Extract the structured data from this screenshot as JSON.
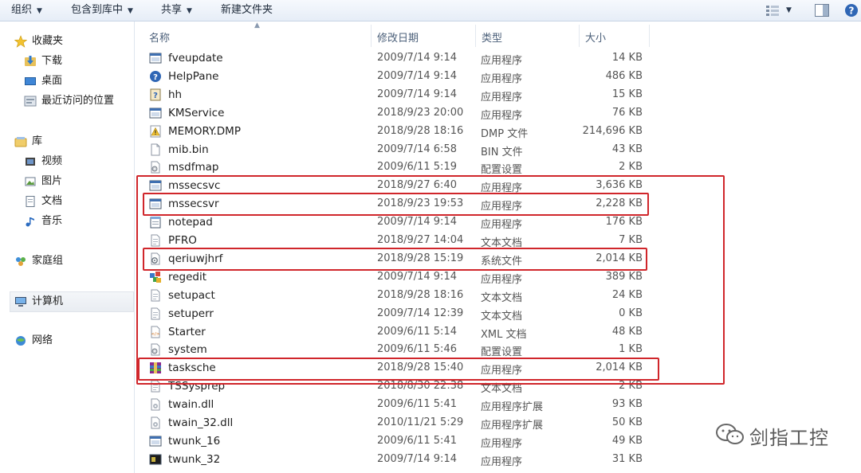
{
  "toolbar": {
    "organize": "组织",
    "include_in_library": "包含到库中",
    "share": "共享",
    "new_folder": "新建文件夹",
    "icons": [
      "view-icon",
      "chevron-down-icon",
      "preview-pane-icon",
      "help-icon"
    ]
  },
  "sidebar": {
    "favorites": {
      "label": "收藏夹",
      "icon": "star-icon"
    },
    "favorites_items": [
      {
        "label": "下载",
        "icon": "download-folder-icon"
      },
      {
        "label": "桌面",
        "icon": "desktop-icon"
      },
      {
        "label": "最近访问的位置",
        "icon": "recent-places-icon"
      }
    ],
    "libraries": {
      "label": "库",
      "icon": "library-icon"
    },
    "libraries_items": [
      {
        "label": "视频",
        "icon": "video-icon"
      },
      {
        "label": "图片",
        "icon": "picture-icon"
      },
      {
        "label": "文档",
        "icon": "document-icon"
      },
      {
        "label": "音乐",
        "icon": "music-icon"
      }
    ],
    "homegroup": {
      "label": "家庭组",
      "icon": "homegroup-icon"
    },
    "computer": {
      "label": "计算机",
      "icon": "computer-icon"
    },
    "network": {
      "label": "网络",
      "icon": "network-icon"
    }
  },
  "columns": {
    "name": "名称",
    "date": "修改日期",
    "type": "类型",
    "size": "大小"
  },
  "files": [
    {
      "name": "fveupdate",
      "date": "2009/7/14 9:14",
      "type": "应用程序",
      "size": "14 KB",
      "icon": "app-icon"
    },
    {
      "name": "HelpPane",
      "date": "2009/7/14 9:14",
      "type": "应用程序",
      "size": "486 KB",
      "icon": "help-app-icon"
    },
    {
      "name": "hh",
      "date": "2009/7/14 9:14",
      "type": "应用程序",
      "size": "15 KB",
      "icon": "help-book-icon"
    },
    {
      "name": "KMService",
      "date": "2018/9/23 20:00",
      "type": "应用程序",
      "size": "76 KB",
      "icon": "app-icon"
    },
    {
      "name": "MEMORY.DMP",
      "date": "2018/9/28 18:16",
      "type": "DMP 文件",
      "size": "214,696 KB",
      "icon": "warning-file-icon"
    },
    {
      "name": "mib.bin",
      "date": "2009/7/14 6:58",
      "type": "BIN 文件",
      "size": "43 KB",
      "icon": "blank-file-icon"
    },
    {
      "name": "msdfmap",
      "date": "2009/6/11 5:19",
      "type": "配置设置",
      "size": "2 KB",
      "icon": "settings-file-icon"
    },
    {
      "name": "mssecsvc",
      "date": "2018/9/27 6:40",
      "type": "应用程序",
      "size": "3,636 KB",
      "icon": "app-icon"
    },
    {
      "name": "mssecsvr",
      "date": "2018/9/23 19:53",
      "type": "应用程序",
      "size": "2,228 KB",
      "icon": "app-icon"
    },
    {
      "name": "notepad",
      "date": "2009/7/14 9:14",
      "type": "应用程序",
      "size": "176 KB",
      "icon": "notepad-icon"
    },
    {
      "name": "PFRO",
      "date": "2018/9/27 14:04",
      "type": "文本文档",
      "size": "7 KB",
      "icon": "text-file-icon"
    },
    {
      "name": "qeriuwjhrf",
      "date": "2018/9/28 15:19",
      "type": "系统文件",
      "size": "2,014 KB",
      "icon": "system-file-icon"
    },
    {
      "name": "regedit",
      "date": "2009/7/14 9:14",
      "type": "应用程序",
      "size": "389 KB",
      "icon": "regedit-icon"
    },
    {
      "name": "setupact",
      "date": "2018/9/28 18:16",
      "type": "文本文档",
      "size": "24 KB",
      "icon": "text-file-icon"
    },
    {
      "name": "setuperr",
      "date": "2009/7/14 12:39",
      "type": "文本文档",
      "size": "0 KB",
      "icon": "text-file-icon"
    },
    {
      "name": "Starter",
      "date": "2009/6/11 5:14",
      "type": "XML 文档",
      "size": "48 KB",
      "icon": "xml-file-icon"
    },
    {
      "name": "system",
      "date": "2009/6/11 5:46",
      "type": "配置设置",
      "size": "1 KB",
      "icon": "settings-file-icon"
    },
    {
      "name": "tasksche",
      "date": "2018/9/28 15:40",
      "type": "应用程序",
      "size": "2,014 KB",
      "icon": "archive-app-icon"
    },
    {
      "name": "TSSysprep",
      "date": "2018/8/30 22:38",
      "type": "文本文档",
      "size": "2 KB",
      "icon": "text-file-icon"
    },
    {
      "name": "twain.dll",
      "date": "2009/6/11 5:41",
      "type": "应用程序扩展",
      "size": "93 KB",
      "icon": "dll-icon"
    },
    {
      "name": "twain_32.dll",
      "date": "2010/11/21 5:29",
      "type": "应用程序扩展",
      "size": "50 KB",
      "icon": "dll-icon"
    },
    {
      "name": "twunk_16",
      "date": "2009/6/11 5:41",
      "type": "应用程序",
      "size": "49 KB",
      "icon": "app-icon"
    },
    {
      "name": "twunk_32",
      "date": "2009/7/14 9:14",
      "type": "应用程序",
      "size": "31 KB",
      "icon": "terminal-app-icon"
    }
  ],
  "watermark": {
    "text": "剑指工控",
    "icon": "wechat-icon"
  },
  "colors": {
    "highlight": "#d0262b",
    "toolbar_bg": "#e6edf7",
    "sidebar_border": "#dfe6ef"
  }
}
